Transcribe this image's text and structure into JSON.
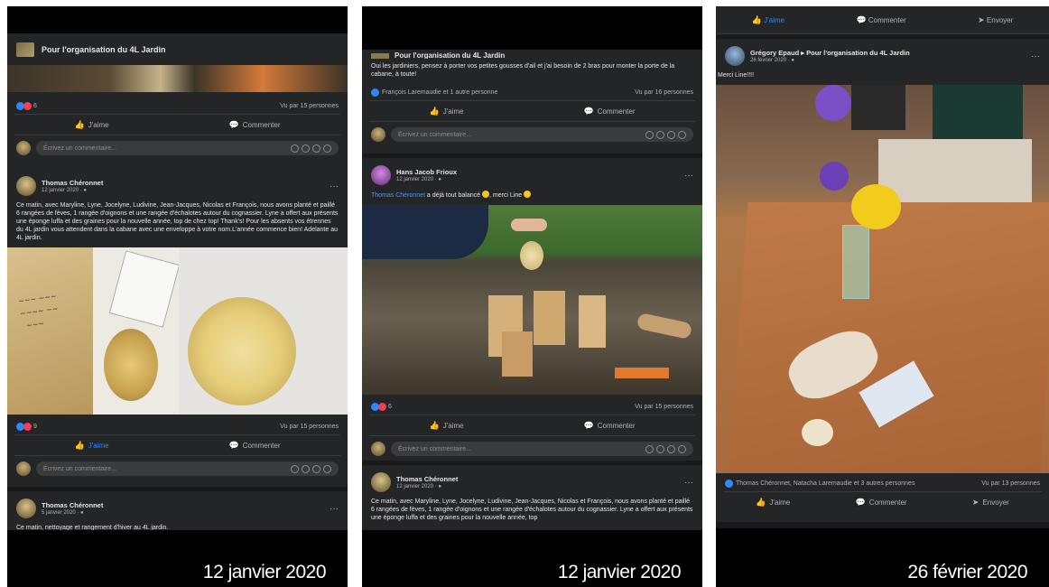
{
  "panel1": {
    "group_title": "Pour l'organisation du 4L Jardin",
    "post1": {
      "react_count": "6",
      "seen": "Vu par 15 personnes"
    },
    "like_label": "J'aime",
    "comment_label": "Commenter",
    "comment_placeholder": "Écrivez un commentaire...",
    "post2": {
      "author": "Thomas Chéronnet",
      "date": "12 janvier 2020 · ",
      "text": "Ce matin, avec Maryline, Lyne, Jocelyne, Ludivine, Jean-Jacques, Nicolas et François, nous avons planté et paillé 6 rangées de fèves, 1 rangée d'oignons et une rangée d'échalotes autour du cognassier. Lyne a offert aux présents une éponge luffa et des graines pour la nouvelle année, top de chez top! Thank's! Pour les absents vos étrennes du 4L jardin vous attendent dans la cabane avec une enveloppe à votre nom.L'année commence bien! Adelante au 4L jardin.",
      "react_count": "9",
      "seen": "Vu par 15 personnes"
    },
    "post3": {
      "author": "Thomas Chéronnet",
      "date": "5 janvier 2020 · ",
      "text": "Ce matin, nettoyage et rangement  d'hiver au 4L jardin."
    },
    "caption": "12 janvier 2020"
  },
  "panel2": {
    "cut_header": "Pour l'organisation du 4L Jardin",
    "intro_text": "Oui les jardiniers, pensez à porter vos petites gousses d'ail et j'ai besoin de 2 bras pour monter la porte de la cabane, à toute!",
    "liked_by": "François Laremaudie et 1 autre personne",
    "seen1": "Vu par 16 personnes",
    "like_label": "J'aime",
    "comment_label": "Commenter",
    "comment_placeholder": "Écrivez un commentaire...",
    "post2": {
      "author": "Hans Jacob Frioux",
      "date": "12 janvier 2020 · ",
      "mention": "Thomas Chéronnet",
      "text": " a déjà tout balancé ",
      "text2": ", merci Line ",
      "react_count": "6",
      "seen": "Vu par 15 personnes"
    },
    "post3": {
      "author": "Thomas Chéronnet",
      "date": "12 janvier 2020 · ",
      "text": "Ce matin, avec Maryline, Lyne, Jocelyne, Ludivine, Jean-Jacques, Nicolas et François, nous avons planté et paillé 6 rangées de fèves, 1 rangée d'oignons et une rangée d'échalotes autour du cognassier. Lyne a offert aux présents une éponge luffa et des graines pour la nouvelle année, top"
    },
    "caption": "12 janvier 2020"
  },
  "panel3": {
    "top_like": "J'aime",
    "top_comment": "Commenter",
    "top_send": "Envoyer",
    "post": {
      "author": "Grégory Epaud ▸ Pour l'organisation du 4L Jardin",
      "date": "26 février 2020 · ",
      "text": "Merci Line!!!!",
      "liked_by": "Thomas Chéronnet, Natacha Laremaudie et 3 autres personnes",
      "seen": "Vu par 13 personnes"
    },
    "like_label": "J'aime",
    "comment_label": "Commenter",
    "send_label": "Envoyer",
    "caption": "26 février 2020"
  }
}
